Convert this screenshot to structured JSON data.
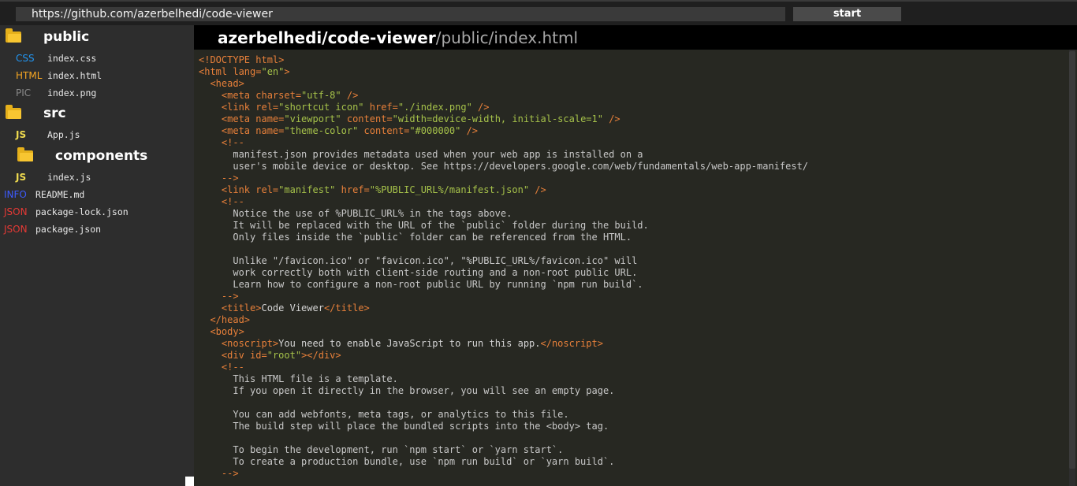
{
  "url_bar": {
    "value": "https://github.com/azerbelhedi/code-viewer",
    "start_label": "start"
  },
  "sidebar": {
    "folders": {
      "public": {
        "name": "public"
      },
      "src": {
        "name": "src"
      },
      "components": {
        "name": "components"
      }
    },
    "files": {
      "public_index_css": {
        "badge": "CSS",
        "badge_color": "#2196f3",
        "name": "index.css"
      },
      "public_index_html": {
        "badge": "HTML",
        "badge_color": "#f5a623",
        "name": "index.html"
      },
      "public_index_png": {
        "badge": "PIC",
        "badge_color": "#8a8a8a",
        "name": "index.png"
      },
      "src_app_js": {
        "badge": "JS",
        "badge_color": "#f0db4f",
        "name": "App.js"
      },
      "src_index_js": {
        "badge": "JS",
        "badge_color": "#f0db4f",
        "name": "index.js"
      },
      "readme": {
        "badge": "INFO",
        "badge_color": "#3d5afe",
        "name": "README.md"
      },
      "package_lock": {
        "badge": "JSON",
        "badge_color": "#e53935",
        "name": "package-lock.json"
      },
      "package_json": {
        "badge": "JSON",
        "badge_color": "#e53935",
        "name": "package.json"
      }
    }
  },
  "file_path": {
    "repo": "azerbelhedi/code-viewer",
    "path": "/public/index.html"
  },
  "colors": {
    "tag": "#e8803a",
    "string": "#a6c24a",
    "text": "#d4d4d4",
    "comment": "#c8c8c8"
  },
  "code": [
    [
      {
        "t": "<!DOCTYPE html>",
        "c": "tag"
      }
    ],
    [
      {
        "t": "<html lang=",
        "c": "tag"
      },
      {
        "t": "\"en\"",
        "c": "string"
      },
      {
        "t": ">",
        "c": "tag"
      }
    ],
    [
      {
        "t": "  <head>",
        "c": "tag"
      }
    ],
    [
      {
        "t": "    <meta charset=",
        "c": "tag"
      },
      {
        "t": "\"utf-8\"",
        "c": "string"
      },
      {
        "t": " />",
        "c": "tag"
      }
    ],
    [
      {
        "t": "    <link rel=",
        "c": "tag"
      },
      {
        "t": "\"shortcut icon\"",
        "c": "string"
      },
      {
        "t": " href=",
        "c": "tag"
      },
      {
        "t": "\"./index.png\"",
        "c": "string"
      },
      {
        "t": " />",
        "c": "tag"
      }
    ],
    [
      {
        "t": "    <meta name=",
        "c": "tag"
      },
      {
        "t": "\"viewport\"",
        "c": "string"
      },
      {
        "t": " content=",
        "c": "tag"
      },
      {
        "t": "\"width=device-width, initial-scale=1\"",
        "c": "string"
      },
      {
        "t": " />",
        "c": "tag"
      }
    ],
    [
      {
        "t": "    <meta name=",
        "c": "tag"
      },
      {
        "t": "\"theme-color\"",
        "c": "string"
      },
      {
        "t": " content=",
        "c": "tag"
      },
      {
        "t": "\"#000000\"",
        "c": "string"
      },
      {
        "t": " />",
        "c": "tag"
      }
    ],
    [
      {
        "t": "    <!--",
        "c": "tag"
      }
    ],
    [
      {
        "t": "      manifest.json provides metadata used when your web app is installed on a",
        "c": "comment"
      }
    ],
    [
      {
        "t": "      user's mobile device or desktop. See https://developers.google.com/web/fundamentals/web-app-manifest/",
        "c": "comment"
      }
    ],
    [
      {
        "t": "    -->",
        "c": "tag"
      }
    ],
    [
      {
        "t": "    <link rel=",
        "c": "tag"
      },
      {
        "t": "\"manifest\"",
        "c": "string"
      },
      {
        "t": " href=",
        "c": "tag"
      },
      {
        "t": "\"%PUBLIC_URL%/manifest.json\"",
        "c": "string"
      },
      {
        "t": " />",
        "c": "tag"
      }
    ],
    [
      {
        "t": "    <!--",
        "c": "tag"
      }
    ],
    [
      {
        "t": "      Notice the use of %PUBLIC_URL% in the tags above.",
        "c": "comment"
      }
    ],
    [
      {
        "t": "      It will be replaced with the URL of the `public` folder during the build.",
        "c": "comment"
      }
    ],
    [
      {
        "t": "      Only files inside the `public` folder can be referenced from the HTML.",
        "c": "comment"
      }
    ],
    [
      {
        "t": "",
        "c": "comment"
      }
    ],
    [
      {
        "t": "      Unlike \"/favicon.ico\" or \"favicon.ico\", \"%PUBLIC_URL%/favicon.ico\" will",
        "c": "comment"
      }
    ],
    [
      {
        "t": "      work correctly both with client-side routing and a non-root public URL.",
        "c": "comment"
      }
    ],
    [
      {
        "t": "      Learn how to configure a non-root public URL by running `npm run build`.",
        "c": "comment"
      }
    ],
    [
      {
        "t": "    -->",
        "c": "tag"
      }
    ],
    [
      {
        "t": "    <title>",
        "c": "tag"
      },
      {
        "t": "Code Viewer",
        "c": "text"
      },
      {
        "t": "</title>",
        "c": "tag"
      }
    ],
    [
      {
        "t": "  </head>",
        "c": "tag"
      }
    ],
    [
      {
        "t": "  <body>",
        "c": "tag"
      }
    ],
    [
      {
        "t": "    <noscript>",
        "c": "tag"
      },
      {
        "t": "You need to enable JavaScript to run this app.",
        "c": "text"
      },
      {
        "t": "</noscript>",
        "c": "tag"
      }
    ],
    [
      {
        "t": "    <div id=",
        "c": "tag"
      },
      {
        "t": "\"root\"",
        "c": "string"
      },
      {
        "t": "></div>",
        "c": "tag"
      }
    ],
    [
      {
        "t": "    <!--",
        "c": "tag"
      }
    ],
    [
      {
        "t": "      This HTML file is a template.",
        "c": "comment"
      }
    ],
    [
      {
        "t": "      If you open it directly in the browser, you will see an empty page.",
        "c": "comment"
      }
    ],
    [
      {
        "t": "",
        "c": "comment"
      }
    ],
    [
      {
        "t": "      You can add webfonts, meta tags, or analytics to this file.",
        "c": "comment"
      }
    ],
    [
      {
        "t": "      The build step will place the bundled scripts into the <body> tag.",
        "c": "comment"
      }
    ],
    [
      {
        "t": "",
        "c": "comment"
      }
    ],
    [
      {
        "t": "      To begin the development, run `npm start` or `yarn start`.",
        "c": "comment"
      }
    ],
    [
      {
        "t": "      To create a production bundle, use `npm run build` or `yarn build`.",
        "c": "comment"
      }
    ],
    [
      {
        "t": "    -->",
        "c": "tag"
      }
    ]
  ]
}
